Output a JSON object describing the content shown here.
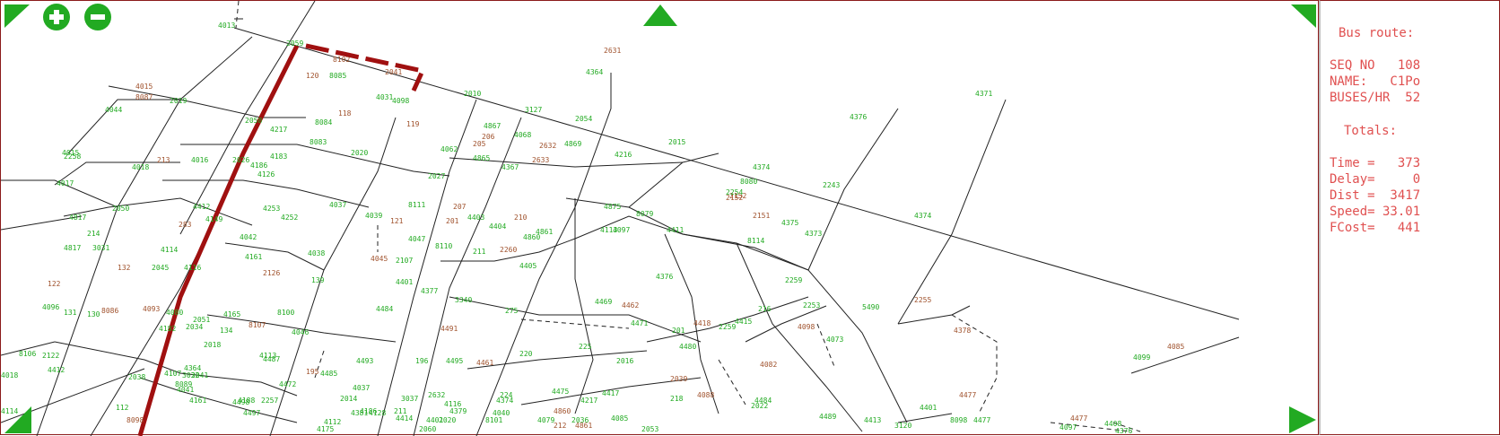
{
  "controls": {
    "zoom_in_icon": "plus-circle-icon",
    "zoom_out_icon": "minus-circle-icon",
    "pan_up_icon": "triangle-up-icon",
    "pan_corner_icon": "triangle-corner-icon",
    "pan_left_icon": "triangle-left-icon",
    "pan_right_icon": "triangle-right-icon"
  },
  "panel": {
    "title": "Bus route:",
    "seq_no": "SEQ NO   108",
    "name": "NAME:   C1Po",
    "buses_hr": "BUSES/HR  52",
    "totals_title": "Totals:",
    "time": "Time =   373",
    "delay": "Delay=     0",
    "dist": "Dist =  3417",
    "speed": "Speed= 33.01",
    "fcost": "FCost=   441"
  },
  "colors": {
    "node_green": "#22aa22",
    "zone_brown": "#a0522d",
    "route_red": "#a01010",
    "link": "#222222",
    "panel_text": "#e05050"
  },
  "map": {
    "nodes": [
      "4013",
      "2059",
      "8102",
      "2041",
      "4364",
      "2631",
      "120",
      "8085",
      "4031",
      "4098",
      "119",
      "118",
      "8084",
      "2010",
      "3127",
      "2054",
      "4044",
      "2019",
      "2058",
      "4217",
      "8083",
      "4869",
      "4867",
      "4068",
      "2632",
      "2015",
      "4015",
      "4016",
      "4017",
      "4018",
      "213",
      "2026",
      "4186",
      "4183",
      "4126",
      "2020",
      "4062",
      "205",
      "206",
      "4865",
      "2633",
      "4367",
      "4216",
      "2152",
      "8080",
      "4374",
      "2243",
      "4376",
      "4371",
      "2050",
      "4817",
      "4817b",
      "3031",
      "4114",
      "283",
      "4149",
      "4253",
      "4252",
      "4037",
      "4039",
      "121",
      "2027",
      "8111",
      "207",
      "201",
      "4403",
      "4404",
      "210",
      "4860",
      "4861",
      "4875",
      "8079",
      "4113",
      "4411",
      "2151",
      "4375",
      "4373",
      "4374b",
      "8114",
      "2152b",
      "4116",
      "132",
      "2045",
      "4042",
      "4161",
      "2126",
      "4038",
      "139",
      "4045",
      "4047",
      "8110",
      "2107",
      "4401",
      "211",
      "2260",
      "4405",
      "4376b",
      "2254",
      "2259",
      "4097",
      "4096",
      "131",
      "130",
      "8086",
      "4093",
      "4080",
      "2051",
      "4165",
      "8100",
      "4046",
      "4484",
      "4377",
      "3340",
      "275",
      "4469",
      "4462",
      "4471",
      "201b",
      "4480",
      "4418",
      "4415",
      "216",
      "2255",
      "5490",
      "4378",
      "2253",
      "4098b",
      "4099",
      "4085",
      "4073",
      "134",
      "2034",
      "4182",
      "2018",
      "8107",
      "4487",
      "4485",
      "195",
      "4493",
      "196",
      "4495",
      "4491",
      "220",
      "4461",
      "225",
      "2016",
      "2039",
      "2259b",
      "4082",
      "2038",
      "4107",
      "2041b",
      "4161b",
      "4188",
      "4497",
      "4498",
      "2257",
      "4472",
      "224",
      "4475",
      "4417",
      "218",
      "4088",
      "4484b",
      "4401b",
      "4477",
      "8106",
      "2122",
      "4412",
      "4379",
      "4374c",
      "4128",
      "4041",
      "3032",
      "4114b",
      "8098",
      "112",
      "4018b",
      "122",
      "214",
      "4015b",
      "8087",
      "2258",
      "4412b",
      "8089",
      "211b",
      "4414",
      "4381",
      "4364b",
      "4113b",
      "4037b",
      "2014",
      "4186b",
      "3037",
      "2632b",
      "4116b",
      "4040",
      "2020b",
      "8101",
      "4401c",
      "2060",
      "4112",
      "4175",
      "212",
      "4861b",
      "4860b",
      "4079",
      "2036",
      "4217b",
      "4085b",
      "2053",
      "2022",
      "4489",
      "4413",
      "3120",
      "8098b",
      "4477b",
      "4477c",
      "4376c",
      "4408",
      "4097b"
    ]
  }
}
